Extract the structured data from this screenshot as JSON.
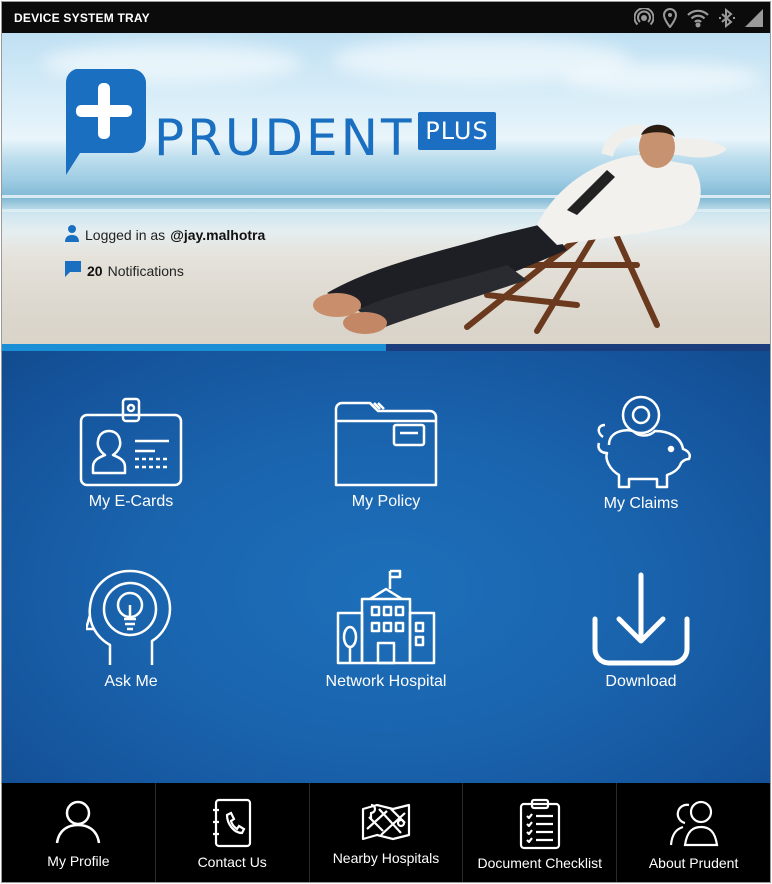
{
  "status_bar": {
    "title": "DEVICE SYSTEM TRAY",
    "icons": [
      "hotspot-icon",
      "location-icon",
      "wifi-icon",
      "bluetooth-icon",
      "signal-icon"
    ]
  },
  "hero": {
    "brand_name": "PRUDENT",
    "brand_badge": "PLUS",
    "logged_in_prefix": "Logged in as",
    "username": "@jay.malhotra",
    "notification_count": "20",
    "notification_label": "Notifications",
    "slider_progress_percent": 50
  },
  "tiles": [
    {
      "label": "My E-Cards",
      "icon": "id-card-icon"
    },
    {
      "label": "My Policy",
      "icon": "folder-icon"
    },
    {
      "label": "My Claims",
      "icon": "piggy-bank-icon"
    },
    {
      "label": "Ask Me",
      "icon": "head-lightbulb-icon"
    },
    {
      "label": "Network Hospital",
      "icon": "hospital-icon"
    },
    {
      "label": "Download",
      "icon": "download-icon"
    }
  ],
  "bottom_nav": [
    {
      "label": "My Profile",
      "icon": "user-icon"
    },
    {
      "label": "Contact Us",
      "icon": "phone-book-icon"
    },
    {
      "label": "Nearby Hospitals",
      "icon": "map-icon"
    },
    {
      "label": "Document Checklist",
      "icon": "clipboard-icon"
    },
    {
      "label": "About Prudent",
      "icon": "users-icon"
    }
  ],
  "colors": {
    "brand_blue": "#1a6fc0",
    "panel_blue": "#1a64ae",
    "progress_track": "#1c3d7b",
    "progress_fill": "#1a8fd6",
    "nav_background": "#000000"
  }
}
